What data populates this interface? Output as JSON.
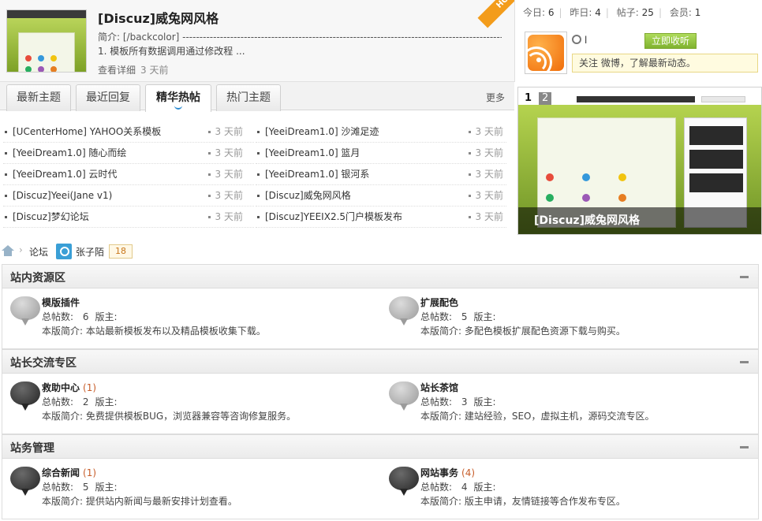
{
  "featured": {
    "title": "[Discuz]威兔网风格",
    "intro": "简介: [/backcolor] ------------------------------------------------------------------------------------------------",
    "line": "1. 模板所有数据调用通过修改程 ...",
    "more_link": "查看详细",
    "time": "3 天前",
    "hot_badge": "HOT"
  },
  "stats": {
    "today_label": "今日:",
    "today_value": "6",
    "yesterday_label": "昨日:",
    "yesterday_value": "4",
    "posts_label": "帖子:",
    "posts_value": "25",
    "members_label": "会员:",
    "members_value": "1"
  },
  "weibo": {
    "name": "l",
    "follow_button": "立即收听",
    "tip": "关注                微博，了解最新动态。"
  },
  "tabs": [
    {
      "label": "最新主题"
    },
    {
      "label": "最近回复"
    },
    {
      "label": "精华热帖"
    },
    {
      "label": "热门主题"
    }
  ],
  "tabs_more": "更多",
  "threads_left": [
    {
      "subject": "[UCenterHome] YAHOO关系模板",
      "time": "3 天前"
    },
    {
      "subject": "[YeeiDream1.0] 随心而绘",
      "time": "3 天前"
    },
    {
      "subject": "[YeeiDream1.0] 云时代",
      "time": "3 天前"
    },
    {
      "subject": "[Discuz]Yeei(Jane v1)",
      "time": "3 天前"
    },
    {
      "subject": "[Discuz]梦幻论坛",
      "time": "3 天前"
    }
  ],
  "threads_right": [
    {
      "subject": "[YeeiDream1.0] 沙滩足迹",
      "time": "3 天前"
    },
    {
      "subject": "[YeeiDream1.0] 篮月",
      "time": "3 天前"
    },
    {
      "subject": "[YeeiDream1.0] 银河系",
      "time": "3 天前"
    },
    {
      "subject": "[Discuz]威兔网风格",
      "time": "3 天前"
    },
    {
      "subject": "[Discuz]YEEIX2.5门户模板发布",
      "time": "3 天前"
    }
  ],
  "slideshow": {
    "current": "1",
    "next": "2",
    "caption": "[Discuz]威兔网风格"
  },
  "breadcrumb": {
    "forum": "论坛",
    "user": "张子陌",
    "badge": "18"
  },
  "colors": {
    "accent_orange": "#f39c1b",
    "follow_green": "#7fb22f",
    "new_count": "#c75d2a"
  },
  "groups": [
    {
      "title": "站内资源区",
      "forums": [
        {
          "name": "模版插件",
          "new": "",
          "icon": "gray",
          "posts_label": "总帖数:",
          "posts": "6",
          "mod_label": "版主:",
          "desc": "本版简介: 本站最新模板发布以及精品模板收集下载。"
        },
        {
          "name": "扩展配色",
          "new": "",
          "icon": "gray",
          "posts_label": "总帖数:",
          "posts": "5",
          "mod_label": "版主:",
          "desc": "本版简介: 多配色模板扩展配色资源下载与购买。"
        }
      ]
    },
    {
      "title": "站长交流专区",
      "forums": [
        {
          "name": "救助中心",
          "new": "(1)",
          "icon": "dark",
          "posts_label": "总帖数:",
          "posts": "2",
          "mod_label": "版主:",
          "desc": "本版简介: 免费提供模板BUG，浏览器兼容等咨询修复服务。"
        },
        {
          "name": "站长茶馆",
          "new": "",
          "icon": "gray",
          "posts_label": "总帖数:",
          "posts": "3",
          "mod_label": "版主:",
          "desc": "本版简介: 建站经验，SEO，虚拟主机，源码交流专区。"
        }
      ]
    },
    {
      "title": "站务管理",
      "forums": [
        {
          "name": "综合新闻",
          "new": "(1)",
          "icon": "dark",
          "posts_label": "总帖数:",
          "posts": "5",
          "mod_label": "版主:",
          "desc": "本版简介: 提供站内新闻与最新安排计划查看。"
        },
        {
          "name": "网站事务",
          "new": "(4)",
          "icon": "dark",
          "posts_label": "总帖数:",
          "posts": "4",
          "mod_label": "版主:",
          "desc": "本版简介: 版主申请，友情链接等合作发布专区。"
        }
      ]
    }
  ]
}
